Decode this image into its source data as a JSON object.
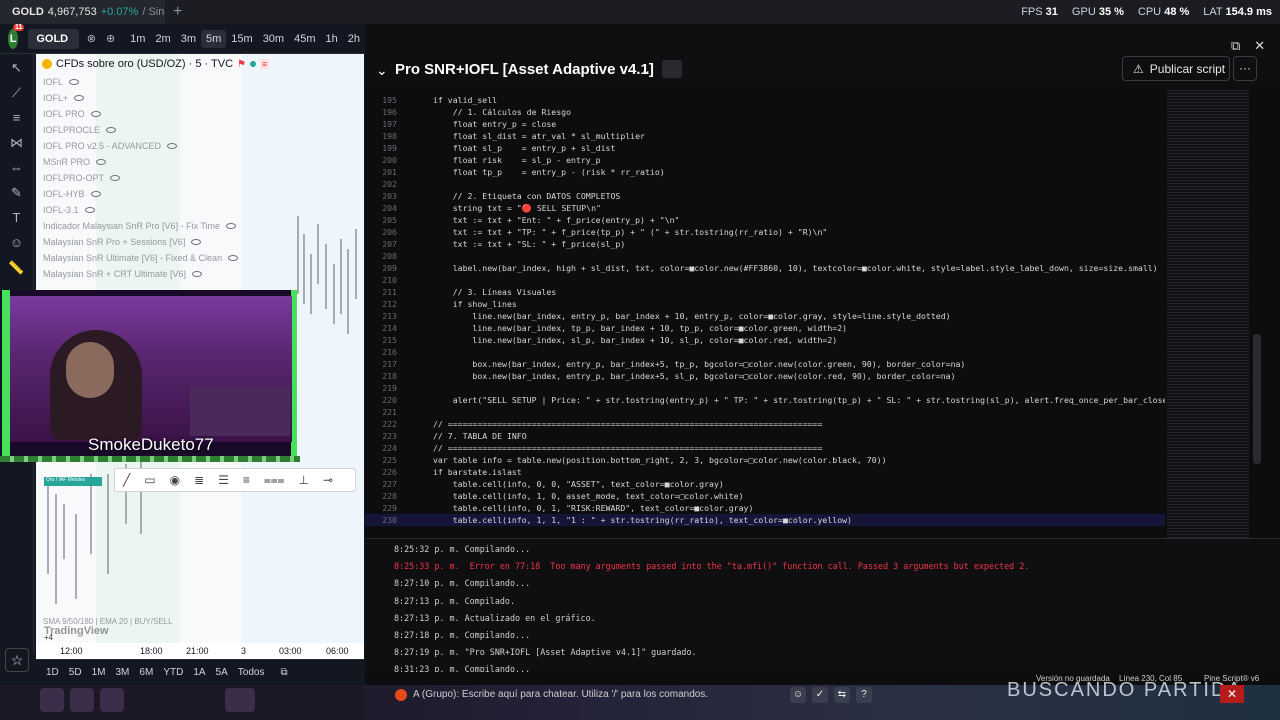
{
  "browser_tab": {
    "symbol": "GOLD",
    "price": "4,967,753",
    "change": "+0.07%",
    "suffix": "/ Sin"
  },
  "perf": {
    "fps_label": "FPS",
    "fps": "31",
    "gpu_label": "GPU",
    "gpu": "35 %",
    "cpu_label": "CPU",
    "cpu": "48 %",
    "lat_label": "LAT",
    "lat": "154.9 ms"
  },
  "chart_toolbar": {
    "avatar": "L",
    "avatar_badge": "11",
    "symbol": "GOLD",
    "timeframes": [
      "1m",
      "2m",
      "3m",
      "5m",
      "15m",
      "30m",
      "45m",
      "1h",
      "2h"
    ],
    "active_timeframe": "5m"
  },
  "chart": {
    "header": "CFDs sobre oro (USD/OZ) · 5 · TVC",
    "indicators": [
      "IOFL",
      "IOFL+",
      "IOFL PRO",
      "IOFLPROCLE",
      "IOFL PRO v2.5 - ADVANCED",
      "MSnR PRO",
      "IOFLPRO-OPT",
      "IOFL-HYB",
      "IOFL-3.1",
      "Indicador Malaysian SnR Pro [V6] - Fix Time",
      "Malaysian SnR Pro + Sessions [V6]",
      "Malaysian SnR Ultimate [V6] - Fixed & Clean",
      "Malaysian SnR + CRT Ultimate [V6]"
    ],
    "footer_indicator": "SMA 9/50/180 | EMA 20 | BUY/SELL",
    "watermark": "TradingView",
    "plus": "+4",
    "x_ticks": [
      "12:00",
      "18:00",
      "21:00",
      "3",
      "03:00",
      "06:00"
    ],
    "pill": "Oro / IAF Metales",
    "ranges": [
      "1D",
      "5D",
      "1M",
      "3M",
      "6M",
      "YTD",
      "1A",
      "5A",
      "Todos"
    ]
  },
  "webcam": {
    "name": "SmokeDuketo77"
  },
  "editor": {
    "title": "Pro SNR+IOFL [Asset Adaptive v4.1]",
    "publish_label": "Publicar script",
    "more": "···",
    "lines": [
      {
        "n": "195",
        "t": "if valid_sell"
      },
      {
        "n": "196",
        "t": "    // 1. Cálculos de Riesgo"
      },
      {
        "n": "197",
        "t": "    float entry_p = close"
      },
      {
        "n": "198",
        "t": "    float sl_dist = atr_val * sl_multiplier"
      },
      {
        "n": "199",
        "t": "    float sl_p    = entry_p + sl_dist"
      },
      {
        "n": "200",
        "t": "    float risk    = sl_p - entry_p"
      },
      {
        "n": "201",
        "t": "    float tp_p    = entry_p - (risk * rr_ratio)"
      },
      {
        "n": "202",
        "t": ""
      },
      {
        "n": "203",
        "t": "    // 2. Etiqueta con DATOS COMPLETOS"
      },
      {
        "n": "204",
        "t": "    string txt = \"🔴 SELL SETUP\\n\""
      },
      {
        "n": "205",
        "t": "    txt := txt + \"Ent: \" + f_price(entry_p) + \"\\n\""
      },
      {
        "n": "206",
        "t": "    txt := txt + \"TP: \" + f_price(tp_p) + \" (\" + str.tostring(rr_ratio) + \"R)\\n\""
      },
      {
        "n": "207",
        "t": "    txt := txt + \"SL: \" + f_price(sl_p)"
      },
      {
        "n": "208",
        "t": ""
      },
      {
        "n": "209",
        "t": "    label.new(bar_index, high + sl_dist, txt, color=■color.new(#FF3860, 10), textcolor=■color.white, style=label.style_label_down, size=size.small)"
      },
      {
        "n": "210",
        "t": ""
      },
      {
        "n": "211",
        "t": "    // 3. Líneas Visuales"
      },
      {
        "n": "212",
        "t": "    if show_lines"
      },
      {
        "n": "213",
        "t": "        line.new(bar_index, entry_p, bar_index + 10, entry_p, color=■color.gray, style=line.style_dotted)"
      },
      {
        "n": "214",
        "t": "        line.new(bar_index, tp_p, bar_index + 10, tp_p, color=■color.green, width=2)"
      },
      {
        "n": "215",
        "t": "        line.new(bar_index, sl_p, bar_index + 10, sl_p, color=■color.red, width=2)"
      },
      {
        "n": "216",
        "t": ""
      },
      {
        "n": "217",
        "t": "        box.new(bar_index, entry_p, bar_index+5, tp_p, bgcolor=□color.new(color.green, 90), border_color=na)"
      },
      {
        "n": "218",
        "t": "        box.new(bar_index, entry_p, bar_index+5, sl_p, bgcolor=□color.new(color.red, 90), border_color=na)"
      },
      {
        "n": "219",
        "t": ""
      },
      {
        "n": "220",
        "t": "    alert(\"SELL SETUP | Price: \" + str.tostring(entry_p) + \" TP: \" + str.tostring(tp_p) + \" SL: \" + str.tostring(sl_p), alert.freq_once_per_bar_close)"
      },
      {
        "n": "221",
        "t": ""
      },
      {
        "n": "222",
        "t": "// ============================================================================"
      },
      {
        "n": "223",
        "t": "// 7. TABLA DE INFO"
      },
      {
        "n": "224",
        "t": "// ============================================================================"
      },
      {
        "n": "225",
        "t": "var table info = table.new(position.bottom_right, 2, 3, bgcolor=□color.new(color.black, 70))"
      },
      {
        "n": "226",
        "t": "if barstate.islast"
      },
      {
        "n": "227",
        "t": "    table.cell(info, 0, 0, \"ASSET\", text_color=■color.gray)"
      },
      {
        "n": "228",
        "t": "    table.cell(info, 1, 0, asset_mode, text_color=□color.white)"
      },
      {
        "n": "229",
        "t": "    table.cell(info, 0, 1, \"RISK:REWARD\", text_color=■color.gray)"
      },
      {
        "n": "230",
        "t": "    table.cell(info, 1, 1, \"1 : \" + str.tostring(rr_ratio), text_color=■color.yellow)"
      }
    ],
    "console": [
      {
        "t": "8:25:32 p. m. Compilando...",
        "err": false
      },
      {
        "t": "8:25:33 p. m.  Error en 77:18  Too many arguments passed into the \"ta.mfi()\" function call. Passed 3 arguments but expected 2.",
        "err": true
      },
      {
        "t": "8:27:10 p. m. Compilando...",
        "err": false
      },
      {
        "t": "8:27:13 p. m. Compilado.",
        "err": false
      },
      {
        "t": "8:27:13 p. m. Actualizado en el gráfico.",
        "err": false
      },
      {
        "t": "8:27:18 p. m. Compilando...",
        "err": false
      },
      {
        "t": "8:27:19 p. m. \"Pro SNR+IOFL [Asset Adaptive v4.1]\" guardado.",
        "err": false
      },
      {
        "t": "8:31:23 p. m. Compilando...",
        "err": false
      }
    ],
    "status": {
      "saved": "Versión no guardada",
      "pos": "Línea 230, Col 85",
      "lang": "Pine Script® v6"
    }
  },
  "chat": {
    "prefix": "A (Grupo):",
    "placeholder": "Escribe aquí para chatear. Utiliza '/' para los comandos.",
    "overlay": "BUSCANDO PARTIDA"
  }
}
